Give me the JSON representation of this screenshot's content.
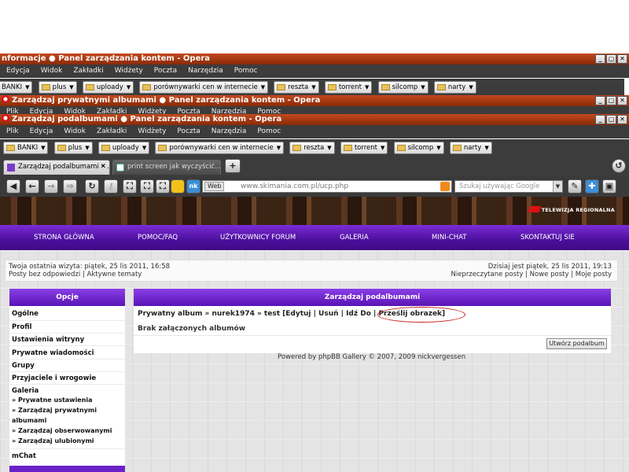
{
  "windows": [
    {
      "title": "nformacje ● Panel zarządzania kontem - Opera",
      "menu": [
        "Edycja",
        "Widok",
        "Zakładki",
        "Widżety",
        "Poczta",
        "Narzędzia",
        "Pomoc"
      ],
      "bookmarks": [
        "BANKI",
        "plus",
        "uploady",
        "porównywarki cen w internecie",
        "reszta",
        "torrent",
        "silcomp",
        "narty"
      ]
    },
    {
      "title": "Zarządzaj prywatnymi albumami ● Panel zarządzania kontem - Opera",
      "menu": [
        "Plik",
        "Edycja",
        "Widok",
        "Zakładki",
        "Widżety",
        "Poczta",
        "Narzędzia",
        "Pomoc"
      ]
    },
    {
      "title": "Zarządzaj podalbumami ● Panel zarządzania kontem - Opera",
      "menu": [
        "Plik",
        "Edycja",
        "Widok",
        "Zakładki",
        "Widżety",
        "Poczta",
        "Narzędzia",
        "Pomoc"
      ],
      "bookmarks": [
        "BANKI",
        "plus",
        "uploady",
        "porównywarki cen w internecie",
        "reszta",
        "torrent",
        "silcomp",
        "narty"
      ]
    }
  ],
  "window_buttons": [
    "_",
    "▢",
    "✕"
  ],
  "tabs": [
    {
      "label": "Zarządzaj podalbumami • ...",
      "active": true
    },
    {
      "label": "print screen jak wyczyścić...",
      "active": false
    }
  ],
  "address": {
    "web_label": "Web",
    "domain": "www.skimania.com.pl",
    "path": "/ucp.php",
    "search_placeholder": "Szukaj używając Google"
  },
  "brand": "TELEWIZJA REGIONALNA",
  "site_nav": [
    "STRONA GŁÓWNA",
    "POMOC/FAQ",
    "UŻYTKOWNICY FORUM",
    "GALERIA",
    "MINI-CHAT",
    "SKONTAKTUJ SIE"
  ],
  "info": {
    "last_visit": "Twoja ostatnia wizyta: piątek, 25 lis 2011, 16:58",
    "left_links": "Posty bez odpowiedzi | Aktywne tematy",
    "today": "Dzisiaj jest piątek, 25 lis 2011, 19:13",
    "right_links": "Nieprzeczytane posty | Nowe posty | Moje posty"
  },
  "sidebar": {
    "heading": "Opcje",
    "items": [
      "Ogólne",
      "Profil",
      "Ustawienia witryny",
      "Prywatne wiadomości",
      "Grupy",
      "Przyjaciele i wrogowie",
      "Galeria"
    ],
    "gallery_sub": [
      "» Prywatne ustawienia",
      "» Zarządzaj prywatnymi",
      "albumami",
      "» Zarządzaj obserwowanymi",
      "» Zarządzaj ulubionymi"
    ],
    "last": "mChat"
  },
  "main": {
    "heading": "Zarządzaj podalbumami",
    "breadcrumb": "Prywatny album » nurek1974 » test [Edytuj | Usuń | Idź Do | Prześlij obrazek]",
    "empty_text": "Brak załączonych albumów",
    "create_button": "Utwórz podalbum",
    "powered_by": "Powered by phpBB Gallery © 2007, 2009 nickvergessen"
  },
  "colors": {
    "title_bar": "#a83a12",
    "site_purple": "#5814b4",
    "highlight_ellipse": "#c81c1c"
  }
}
